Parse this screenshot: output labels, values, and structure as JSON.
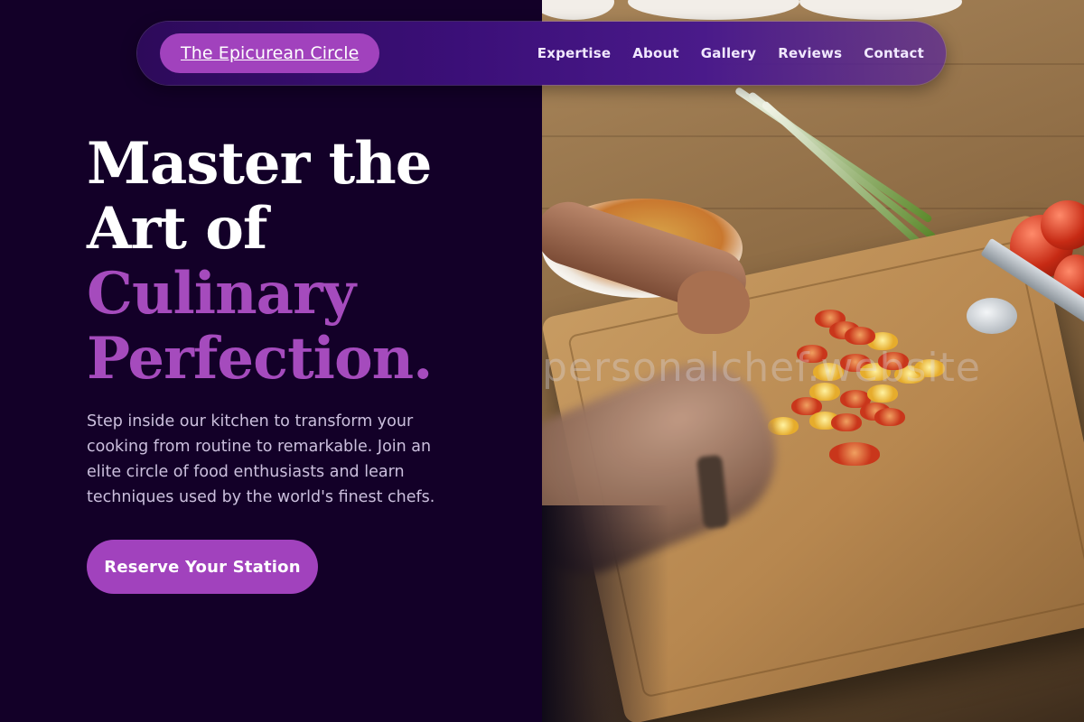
{
  "nav": {
    "brand": "The Epicurean Circle",
    "links": [
      "Expertise",
      "About",
      "Gallery",
      "Reviews",
      "Contact"
    ]
  },
  "hero": {
    "headline_line1": "Master the",
    "headline_line2": "Art of",
    "headline_line3": "Culinary",
    "headline_line4": "Perfection.",
    "subtext": "Step inside our kitchen to transform your cooking from routine to remarkable. Join an elite circle of food enthusiasts and learn techniques used by the world's finest chefs.",
    "cta_label": "Reserve Your Station"
  },
  "image": {
    "watermark": "personalchef.website",
    "alt": "Chef slicing cherry tomatoes on a wooden cutting board"
  },
  "colors": {
    "background": "#130028",
    "accent": "#a142bd",
    "headline_white": "#ffffff",
    "headline_accent": "#a54bbd",
    "subtext": "#cbbfdd",
    "nav_background": "#3b0f78"
  }
}
